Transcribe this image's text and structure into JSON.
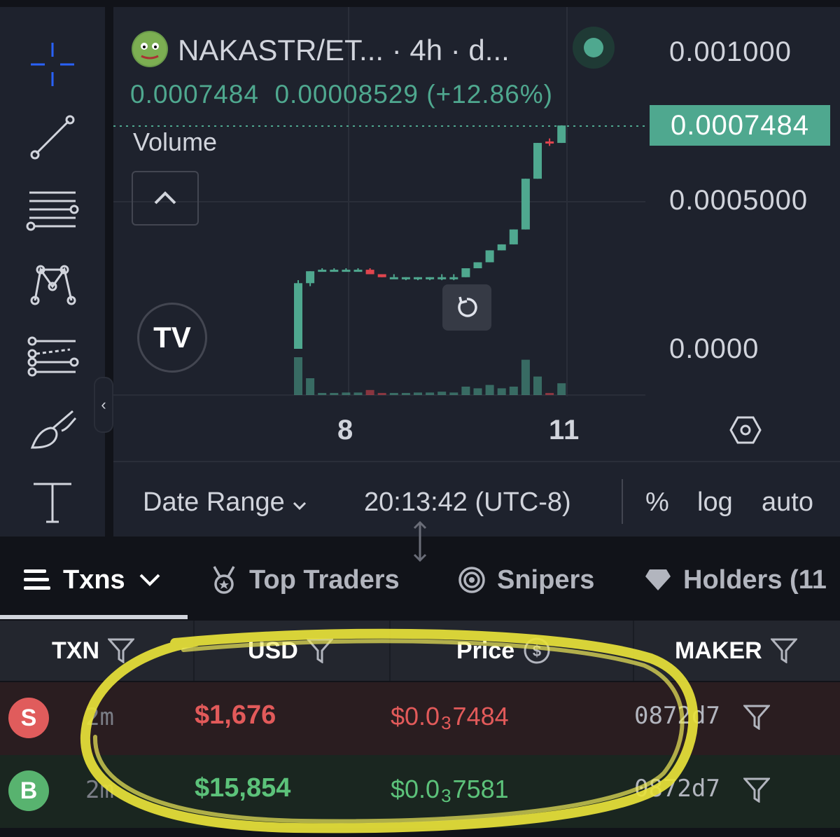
{
  "toolbar": {
    "tools": [
      "crosshair-icon",
      "trend-line-icon",
      "horizontal-lines-icon",
      "pattern-icon",
      "fib-icon",
      "brush-icon",
      "text-icon"
    ],
    "collapse_glyph": "‹"
  },
  "chart": {
    "symbol": "NAKASTR/ET...",
    "interval": " · 4h · d...",
    "close": "0.0007484",
    "change": "0.00008529 (+12.86%)",
    "volume_label": "Volume",
    "logo_text": "TV",
    "price_scale": [
      "0.001000",
      "0.0005000",
      "0.0000"
    ],
    "last_price": "0.0007484",
    "x_ticks": [
      "8",
      "11"
    ],
    "colors": {
      "up": "#4fa88f",
      "down": "#e0454e",
      "background": "#1e222d"
    }
  },
  "chart_data": {
    "type": "candlestick",
    "x_ticks": [
      "8",
      "11"
    ],
    "ylim": [
      0,
      0.001
    ],
    "candles": [
      {
        "o": 0.0,
        "h": 0.00023,
        "l": 0.0,
        "c": 0.00022
      },
      {
        "o": 0.00022,
        "h": 0.00026,
        "l": 0.00021,
        "c": 0.00026
      },
      {
        "o": 0.00026,
        "h": 0.00027,
        "l": 0.00026,
        "c": 0.000265
      },
      {
        "o": 0.000265,
        "h": 0.00027,
        "l": 0.00026,
        "c": 0.000265
      },
      {
        "o": 0.000265,
        "h": 0.00027,
        "l": 0.00026,
        "c": 0.000265
      },
      {
        "o": 0.000265,
        "h": 0.00027,
        "l": 0.00026,
        "c": 0.000265
      },
      {
        "o": 0.000265,
        "h": 0.00027,
        "l": 0.00025,
        "c": 0.00025
      },
      {
        "o": 0.00025,
        "h": 0.00025,
        "l": 0.00024,
        "c": 0.00024
      },
      {
        "o": 0.00024,
        "h": 0.00025,
        "l": 0.00024,
        "c": 0.00024
      },
      {
        "o": 0.00024,
        "h": 0.00024,
        "l": 0.00023,
        "c": 0.00024
      },
      {
        "o": 0.00024,
        "h": 0.00024,
        "l": 0.00023,
        "c": 0.00024
      },
      {
        "o": 0.00024,
        "h": 0.00024,
        "l": 0.00023,
        "c": 0.00024
      },
      {
        "o": 0.00024,
        "h": 0.00025,
        "l": 0.00023,
        "c": 0.00024
      },
      {
        "o": 0.00024,
        "h": 0.00025,
        "l": 0.00023,
        "c": 0.00024
      },
      {
        "o": 0.00024,
        "h": 0.00027,
        "l": 0.00024,
        "c": 0.00027
      },
      {
        "o": 0.00027,
        "h": 0.00029,
        "l": 0.00027,
        "c": 0.00029
      },
      {
        "o": 0.00029,
        "h": 0.00033,
        "l": 0.00029,
        "c": 0.00033
      },
      {
        "o": 0.00033,
        "h": 0.00035,
        "l": 0.00033,
        "c": 0.00035
      },
      {
        "o": 0.00035,
        "h": 0.0004,
        "l": 0.00035,
        "c": 0.0004
      },
      {
        "o": 0.0004,
        "h": 0.00057,
        "l": 0.0004,
        "c": 0.00057
      },
      {
        "o": 0.00057,
        "h": 0.00069,
        "l": 0.00057,
        "c": 0.00069
      },
      {
        "o": 0.000695,
        "h": 0.000705,
        "l": 0.00068,
        "c": 0.00069
      },
      {
        "o": 0.00069,
        "h": 0.000749,
        "l": 0.00069,
        "c": 0.0007484
      }
    ],
    "volume": [
      45,
      20,
      2,
      2,
      3,
      3,
      6,
      2,
      2,
      2,
      3,
      3,
      4,
      3,
      10,
      8,
      12,
      8,
      10,
      42,
      22,
      2,
      14
    ]
  },
  "bottom_bar": {
    "date_range": "Date Range",
    "time": "20:13:42 (UTC-8)",
    "percent": "%",
    "log": "log",
    "auto": "auto"
  },
  "tabs": [
    {
      "label": "Txns",
      "icon": "list-icon"
    },
    {
      "label": "Top Traders",
      "icon": "medal-icon"
    },
    {
      "label": "Snipers",
      "icon": "target-icon"
    },
    {
      "label": "Holders (11",
      "icon": "diamond-icon"
    }
  ],
  "table": {
    "headers": [
      "TXN",
      "USD",
      "Price",
      "MAKER"
    ],
    "rows": [
      {
        "type": "S",
        "age": "2m",
        "usd": "$1,676",
        "price_prefix": "$0.0",
        "price_zeros": "3",
        "price_digits": "7484",
        "maker": "0872d7",
        "color": "#e25a5a",
        "badge_color": "#e05c5c",
        "bg": "#2a1d20"
      },
      {
        "type": "B",
        "age": "2m",
        "usd": "$15,854",
        "price_prefix": "$0.0",
        "price_zeros": "3",
        "price_digits": "7581",
        "maker": "0872d7",
        "color": "#5cc27a",
        "badge_color": "#58b36f",
        "bg": "#1a2620"
      }
    ]
  },
  "highlight_color": "#e8e23a"
}
